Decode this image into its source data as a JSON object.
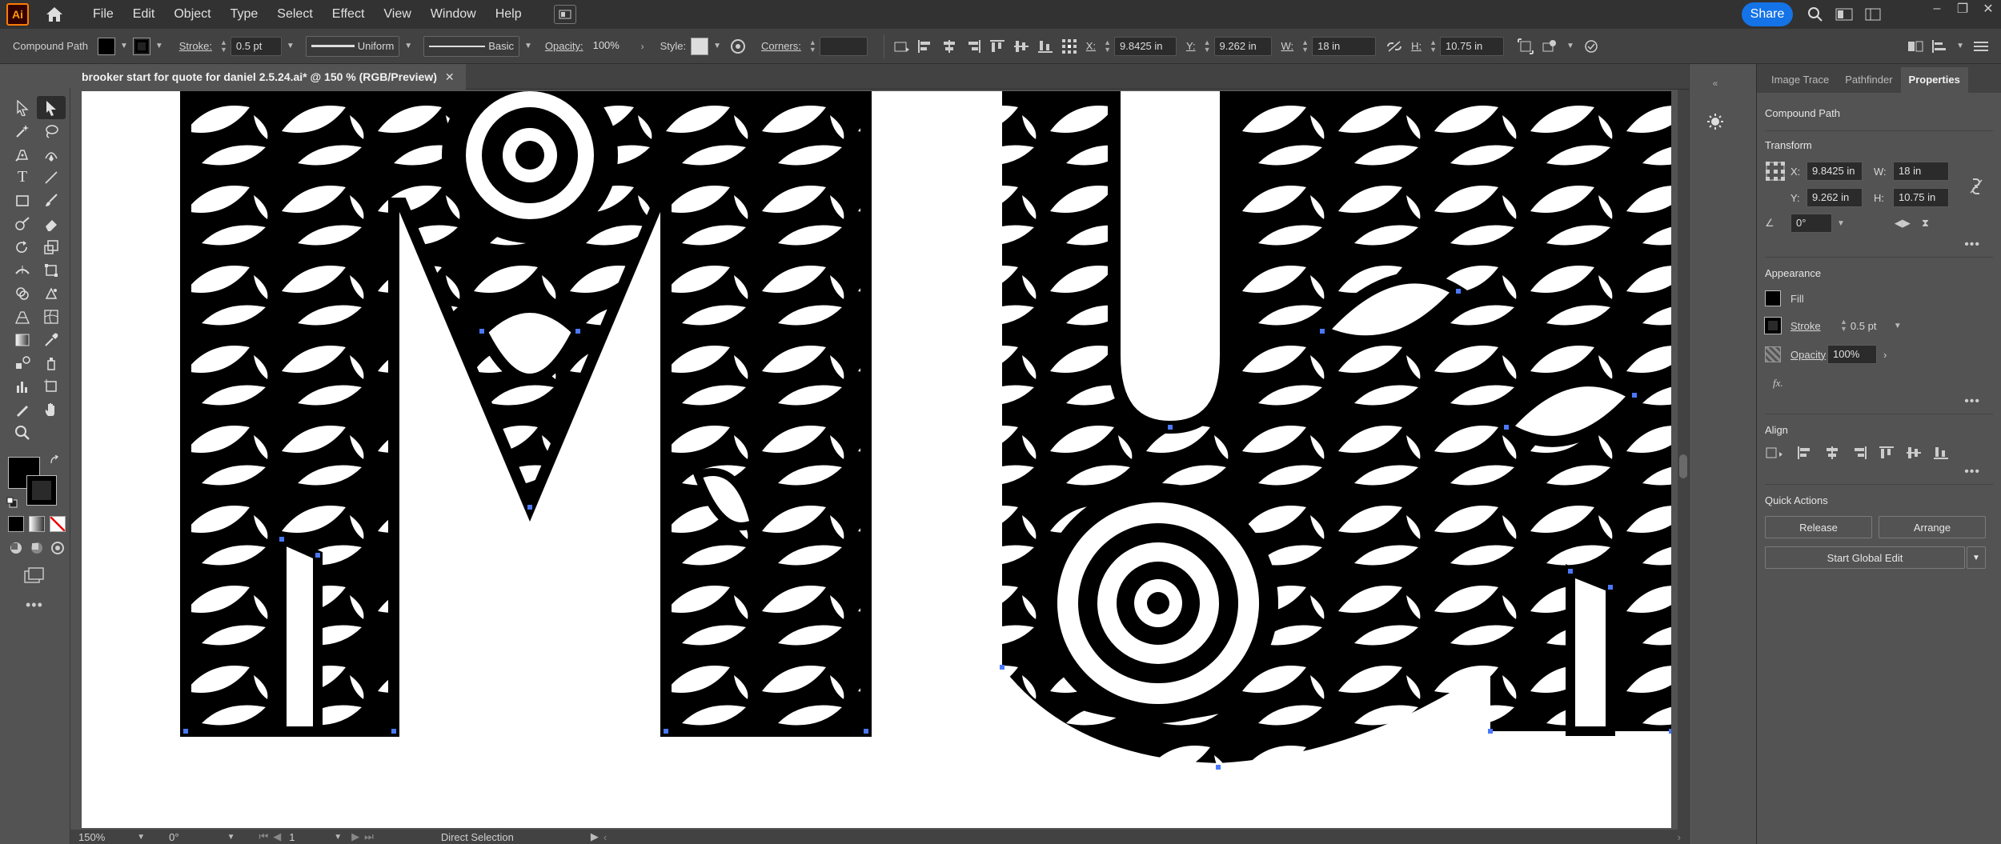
{
  "app": {
    "logo": "Ai"
  },
  "menu": [
    "File",
    "Edit",
    "Object",
    "Type",
    "Select",
    "Effect",
    "View",
    "Window",
    "Help"
  ],
  "share_label": "Share",
  "controlbar": {
    "selection_type": "Compound Path",
    "stroke_label": "Stroke:",
    "stroke_weight": "0.5 pt",
    "profile_label": "Uniform",
    "brush_label": "Basic",
    "opacity_label": "Opacity:",
    "opacity_value": "100%",
    "style_label": "Style:",
    "corners_label": "Corners:",
    "x_label": "X:",
    "x_value": "9.8425 in",
    "y_label": "Y:",
    "y_value": "9.262 in",
    "w_label": "W:",
    "w_value": "18 in",
    "h_label": "H:",
    "h_value": "10.75 in"
  },
  "document": {
    "tab_title": "brooker start for quote for daniel 2.5.24.ai* @ 150 % (RGB/Preview)"
  },
  "status": {
    "zoom": "150%",
    "rotation": "0°",
    "artboard": "1",
    "tool": "Direct Selection"
  },
  "panel": {
    "tabs": [
      "Image Trace",
      "Pathfinder",
      "Properties"
    ],
    "selection": "Compound Path",
    "transform_title": "Transform",
    "x_label": "X:",
    "x_value": "9.8425 in",
    "y_label": "Y:",
    "y_value": "9.262 in",
    "w_label": "W:",
    "w_value": "18 in",
    "h_label": "H:",
    "h_value": "10.75 in",
    "angle_value": "0°",
    "appearance_title": "Appearance",
    "fill_label": "Fill",
    "stroke_label": "Stroke",
    "stroke_value": "0.5 pt",
    "opacity_label": "Opacity",
    "opacity_value": "100%",
    "fx_label": "fx.",
    "align_title": "Align",
    "quick_actions_title": "Quick Actions",
    "release_label": "Release",
    "arrange_label": "Arrange",
    "global_edit_label": "Start Global Edit"
  },
  "colors": {
    "accent": "#1473e6",
    "anchor": "#4a78ff",
    "artwork": "#000000"
  }
}
